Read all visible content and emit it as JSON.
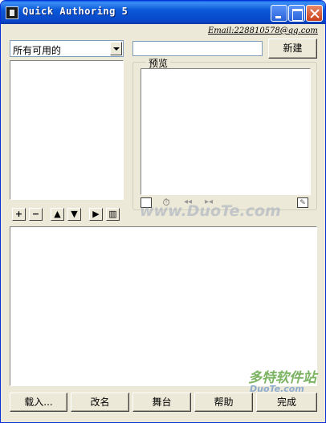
{
  "window": {
    "title": "Quick Authoring 5"
  },
  "email": "Email:228810578@qq.com",
  "source_combo": {
    "value": "所有可用的"
  },
  "name_input": {
    "value": ""
  },
  "buttons": {
    "new": "新建",
    "load": "载入...",
    "rename": "改名",
    "stage": "舞台",
    "help": "帮助",
    "finish": "完成"
  },
  "preview": {
    "label": "预览"
  },
  "icons": {
    "list_tools": [
      "add-icon",
      "remove-icon",
      "move-up-icon",
      "move-down-icon",
      "skip-icon",
      "trash-icon"
    ],
    "preview_tools": [
      "checkbox-icon",
      "clock-icon",
      "step-back-icon",
      "fit-icon",
      "edit-icon"
    ]
  },
  "watermarks": {
    "center": "www.DuoTe.com",
    "logo": "多特软件站",
    "logo_sub": "DuoTe.com"
  }
}
